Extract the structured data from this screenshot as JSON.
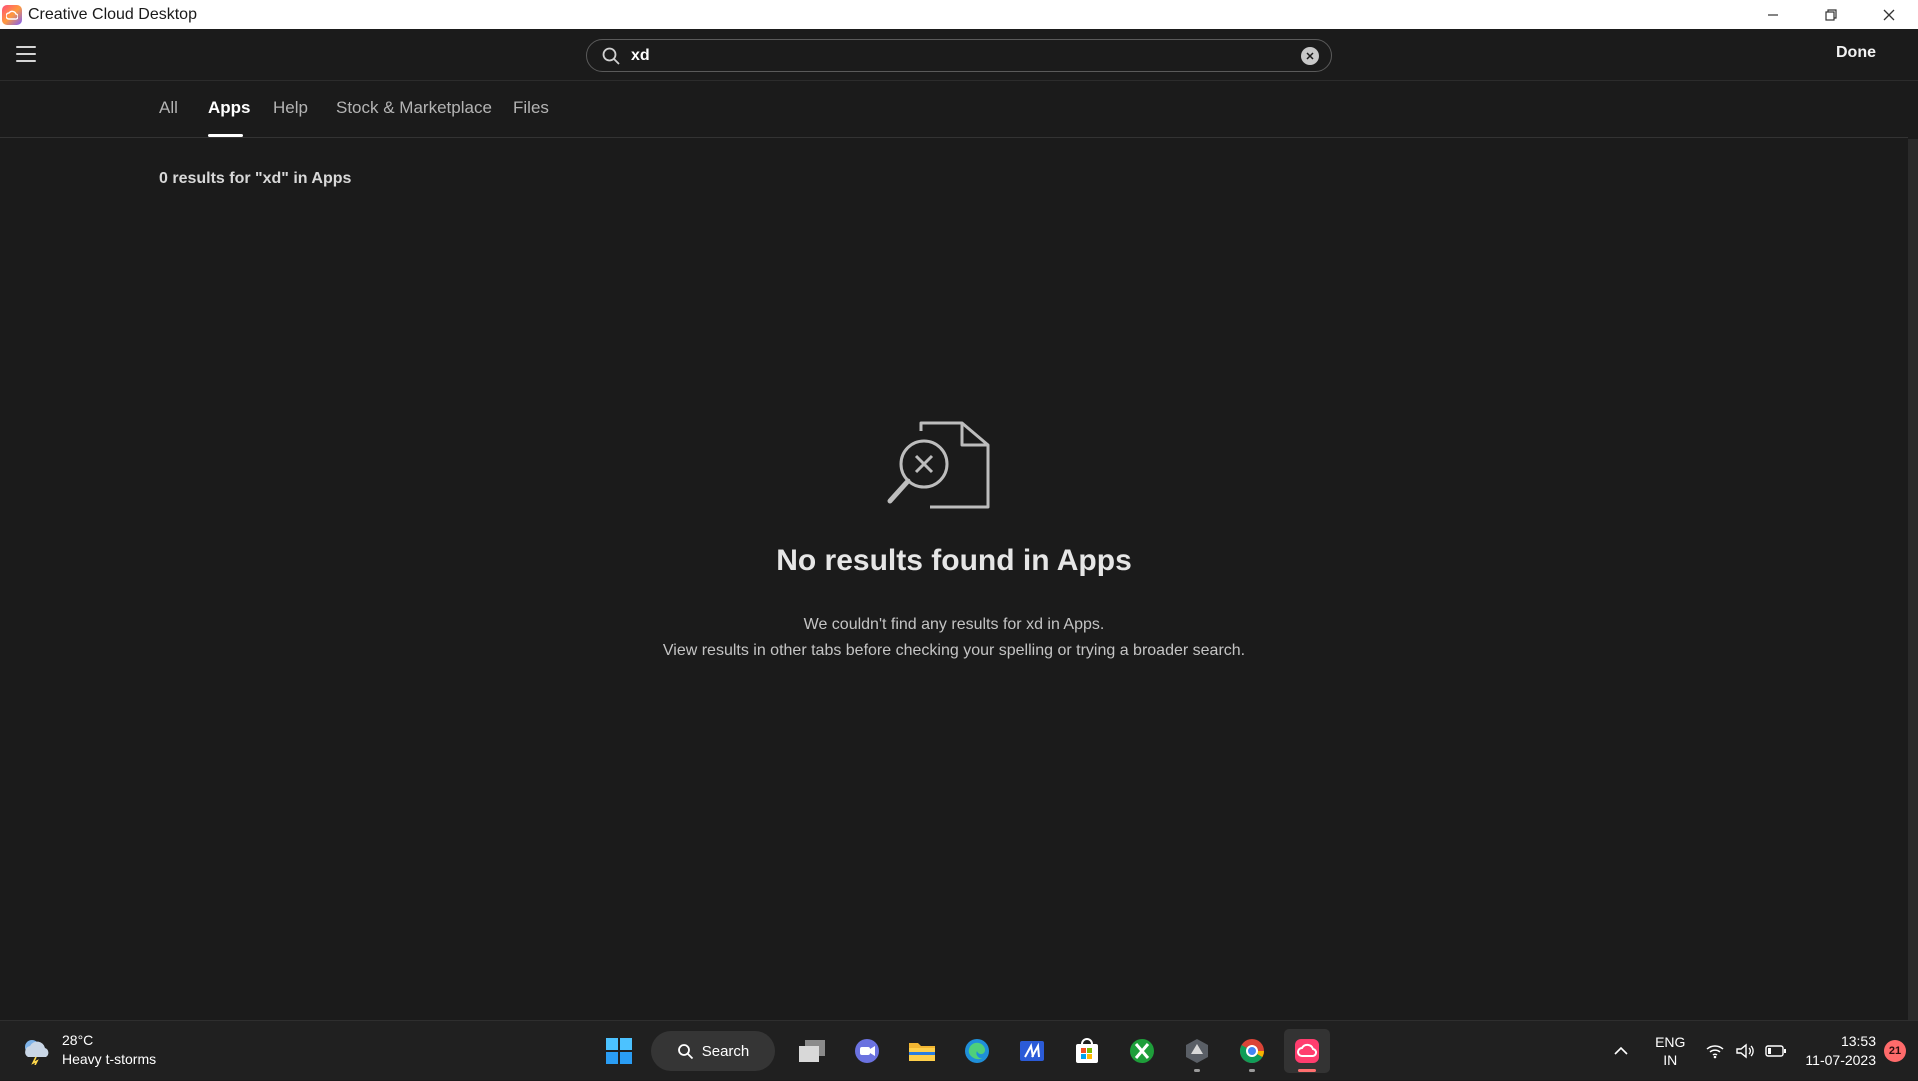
{
  "window": {
    "title": "Creative Cloud Desktop"
  },
  "header": {
    "search": {
      "value": "xd"
    },
    "done_label": "Done"
  },
  "tabs": [
    {
      "label": "All"
    },
    {
      "label": "Apps",
      "active": true
    },
    {
      "label": "Help"
    },
    {
      "label": "Stock & Marketplace"
    },
    {
      "label": "Files"
    }
  ],
  "content": {
    "results_count": "0 results for \"xd\" in Apps",
    "empty_title": "No results found in Apps",
    "empty_line1": "We couldn't find any results for xd in Apps.",
    "empty_line2": "View results in other tabs before checking your spelling or trying a broader search."
  },
  "taskbar": {
    "weather": {
      "temp": "28°C",
      "condition": "Heavy t-storms"
    },
    "search_label": "Search",
    "apps": [
      "start-icon",
      "task-view-icon",
      "meet-icon",
      "file-explorer-icon",
      "edge-icon",
      "app-icon",
      "store-icon",
      "xbox-icon",
      "app-icon",
      "chrome-icon",
      "creative-cloud-icon"
    ],
    "lang": {
      "line1": "ENG",
      "line2": "IN"
    },
    "clock": {
      "time": "13:53",
      "date": "11-07-2023"
    },
    "notification_count": "21"
  },
  "colors": {
    "background": "#1b1b1b",
    "accent": "#ffffff",
    "badge": "#ff6b6b"
  }
}
